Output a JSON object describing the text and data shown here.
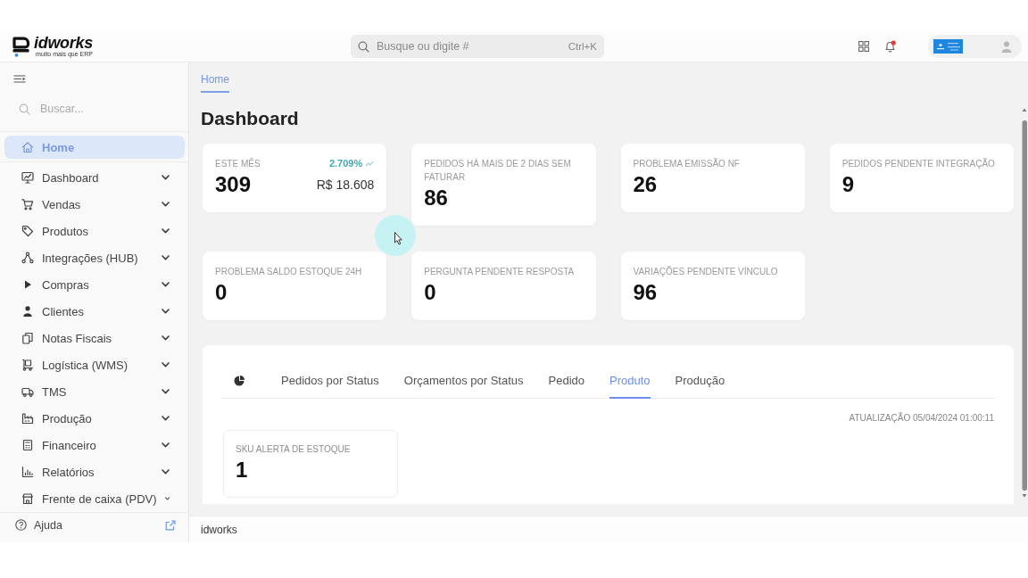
{
  "header": {
    "logo": {
      "name": "idworks",
      "tagline": "muito mais que ERP"
    },
    "search": {
      "placeholder": "Busque ou digite #",
      "shortcut": "Ctrl+K"
    },
    "notifications": {
      "unread": true
    }
  },
  "sidebar": {
    "search": {
      "placeholder": "Buscar..."
    },
    "items": [
      {
        "label": "Home",
        "kind": "link",
        "selected": true
      },
      {
        "label": "Dashboard",
        "kind": "group",
        "selected": false,
        "expanded": false
      },
      {
        "label": "Vendas",
        "kind": "group",
        "selected": false,
        "expanded": false
      },
      {
        "label": "Produtos",
        "kind": "group",
        "selected": false,
        "expanded": false
      },
      {
        "label": "Integrações (HUB)",
        "kind": "group",
        "selected": false,
        "expanded": false
      },
      {
        "label": "Compras",
        "kind": "group",
        "selected": false,
        "expanded": false
      },
      {
        "label": "Clientes",
        "kind": "group",
        "selected": false,
        "expanded": false
      },
      {
        "label": "Notas Fiscais",
        "kind": "group",
        "selected": false,
        "expanded": false
      },
      {
        "label": "Logística (WMS)",
        "kind": "group",
        "selected": false,
        "expanded": false
      },
      {
        "label": "TMS",
        "kind": "group",
        "selected": false,
        "expanded": false
      },
      {
        "label": "Produção",
        "kind": "group",
        "selected": false,
        "expanded": false
      },
      {
        "label": "Financeiro",
        "kind": "group",
        "selected": false,
        "expanded": false
      },
      {
        "label": "Relatórios",
        "kind": "group",
        "selected": false,
        "expanded": false
      },
      {
        "label": "Frente de caixa (PDV)",
        "kind": "group",
        "selected": false,
        "expanded": false
      }
    ],
    "help": {
      "label": "Ajuda"
    }
  },
  "breadcrumbs": [
    {
      "label": "Home",
      "selected": true
    }
  ],
  "page_title": "Dashboard",
  "stat_cards": [
    {
      "kind": "trend",
      "label": "ESTE MÊS",
      "value": "309",
      "change": "2.709%",
      "amount": "R$ 18.608"
    },
    {
      "kind": "count",
      "label": "PEDIDOS HÁ MAIS DE 2 DIAS SEM FATURAR",
      "value": "86"
    },
    {
      "kind": "count",
      "label": "PROBLEMA EMISSÃO NF",
      "value": "26"
    },
    {
      "kind": "count",
      "label": "PEDIDOS PENDENTE INTEGRAÇÃO",
      "value": "9"
    },
    {
      "kind": "count",
      "label": "PROBLEMA SALDO ESTOQUE 24H",
      "value": "0"
    },
    {
      "kind": "count",
      "label": "PERGUNTA PENDENTE RESPOSTA",
      "value": "0"
    },
    {
      "kind": "count",
      "label": "VARIAÇÕES PENDENTE VÍNCULO",
      "value": "96"
    }
  ],
  "panel": {
    "tabs": [
      {
        "label": "Pedidos por Status",
        "selected": false
      },
      {
        "label": "Orçamentos por Status",
        "selected": false
      },
      {
        "label": "Pedido",
        "selected": false
      },
      {
        "label": "Produto",
        "selected": true
      },
      {
        "label": "Produção",
        "selected": false
      }
    ],
    "updated": "ATUALIZAÇÃO 05/04/2024 01:00:11",
    "cards": [
      {
        "label": "SKU ALERTA DE ESTOQUE",
        "value": "1"
      }
    ]
  },
  "footer": {
    "text": "idworks"
  }
}
